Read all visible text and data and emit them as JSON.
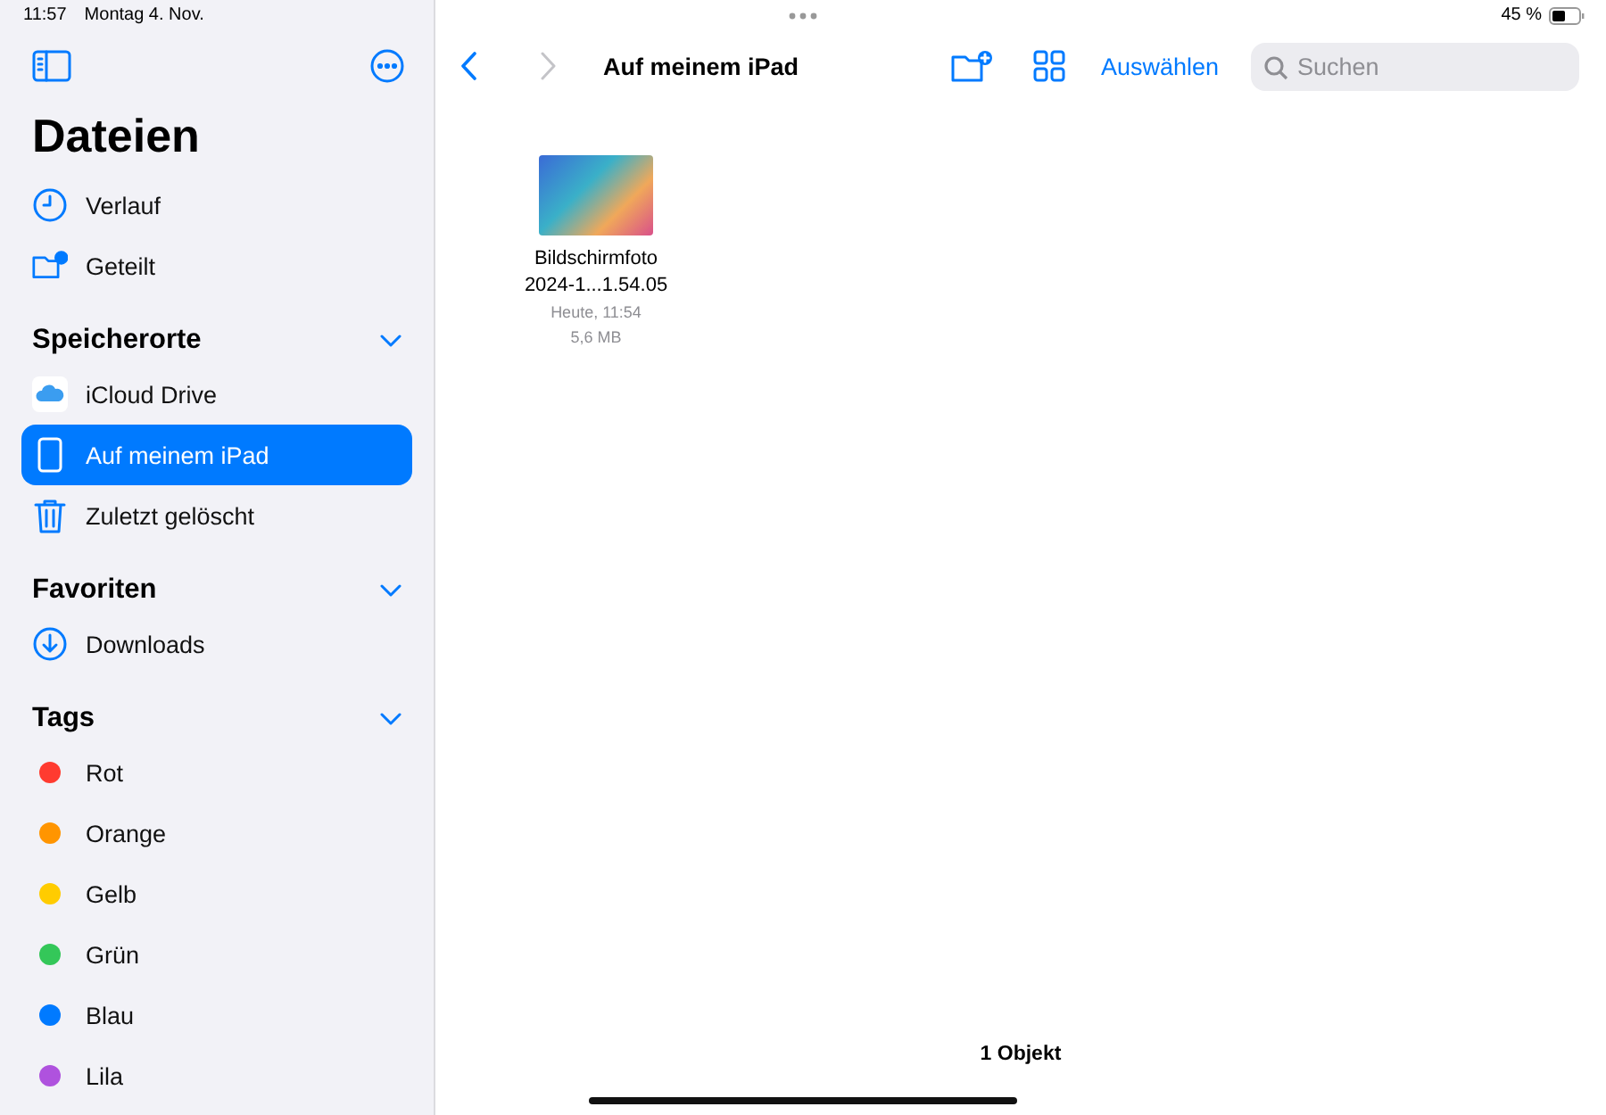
{
  "status_bar": {
    "time": "11:57",
    "date": "Montag 4. Nov.",
    "battery": "45 %"
  },
  "sidebar": {
    "title": "Dateien",
    "items": [
      {
        "label": "Verlauf",
        "selected": false
      },
      {
        "label": "Geteilt",
        "selected": false
      }
    ],
    "sections": [
      {
        "title": "Speicherorte",
        "expanded": true,
        "items": [
          {
            "label": "iCloud Drive",
            "selected": false
          },
          {
            "label": "Auf meinem iPad",
            "selected": true
          },
          {
            "label": "Zuletzt gelöscht",
            "selected": false
          }
        ]
      },
      {
        "title": "Favoriten",
        "expanded": true,
        "items": [
          {
            "label": "Downloads",
            "selected": false
          }
        ]
      },
      {
        "title": "Tags",
        "expanded": true,
        "items": [
          {
            "label": "Rot",
            "color": "#ff3b30",
            "selected": false
          },
          {
            "label": "Orange",
            "color": "#ff9500",
            "selected": false
          },
          {
            "label": "Gelb",
            "color": "#ffcc00",
            "selected": false
          },
          {
            "label": "Grün",
            "color": "#34c759",
            "selected": false
          },
          {
            "label": "Blau",
            "color": "#007aff",
            "selected": false
          },
          {
            "label": "Lila",
            "color": "#af52de",
            "selected": false
          }
        ]
      }
    ]
  },
  "toolbar": {
    "title": "Auf meinem iPad",
    "select": "Auswählen",
    "search": {
      "placeholder": "Suchen"
    }
  },
  "files": [
    {
      "name": "Bildschirmfoto 2024-1...1.54.05",
      "date": "Heute, 11:54",
      "size": "5,6 MB"
    }
  ],
  "footer": "1 Objekt"
}
